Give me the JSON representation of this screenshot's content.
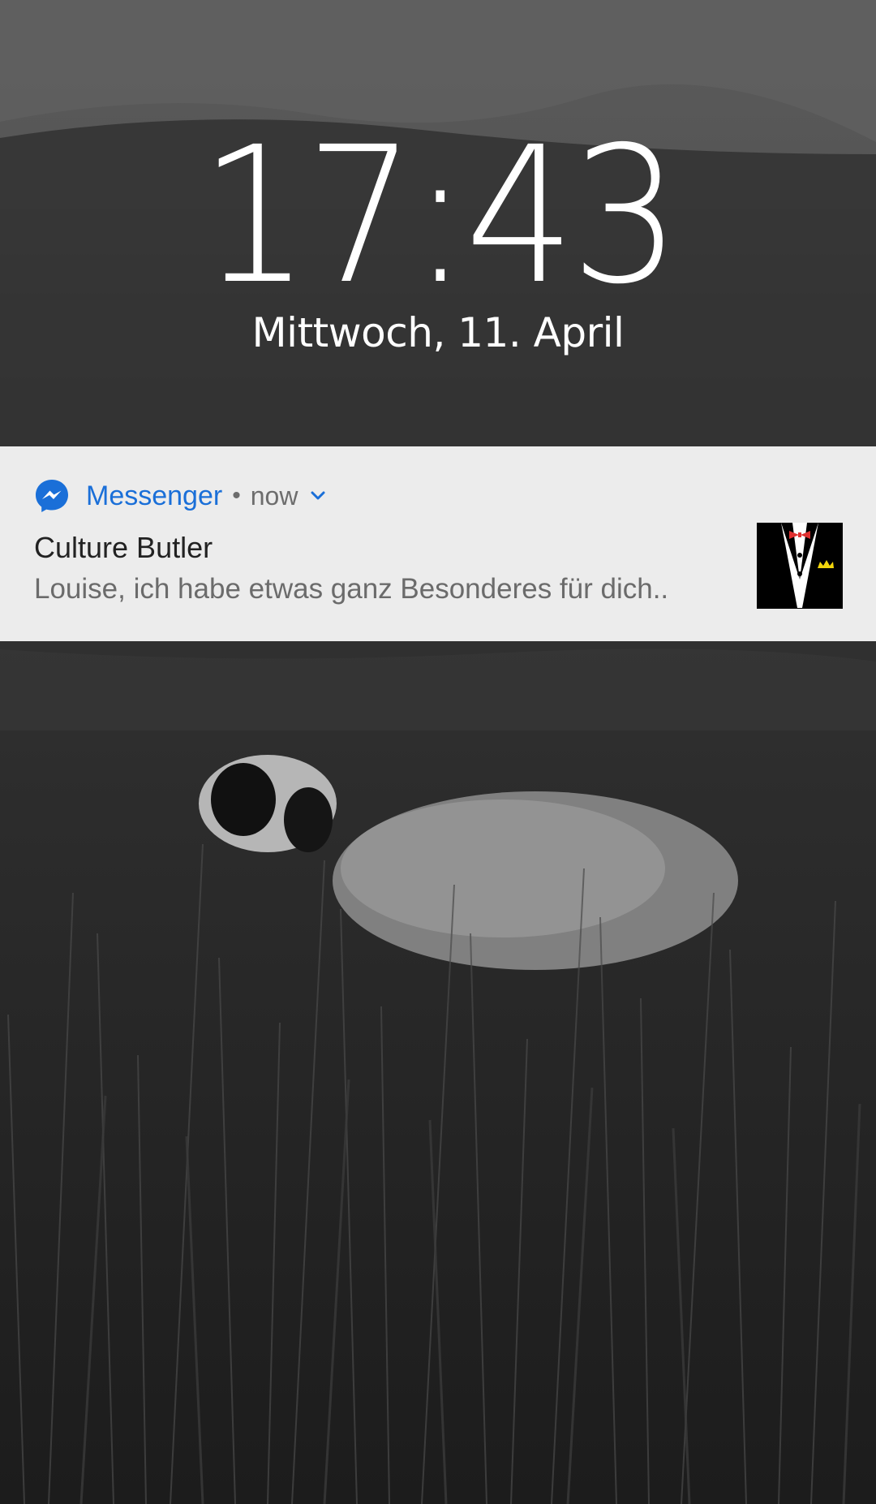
{
  "lockscreen": {
    "time": "17:43",
    "date": "Mittwoch, 11. April"
  },
  "notification": {
    "app_name": "Messenger",
    "separator": "•",
    "timestamp": "now",
    "title": "Culture Butler",
    "text": "Louise, ich habe etwas ganz Besonderes für dich..",
    "app_icon": "messenger-icon",
    "expand_icon": "chevron-down-icon",
    "avatar": "tuxedo-avatar"
  },
  "colors": {
    "accent": "#1a6fd8",
    "notification_bg": "#ececec",
    "bow_tie": "#e03030",
    "crown": "#f2d60c"
  }
}
